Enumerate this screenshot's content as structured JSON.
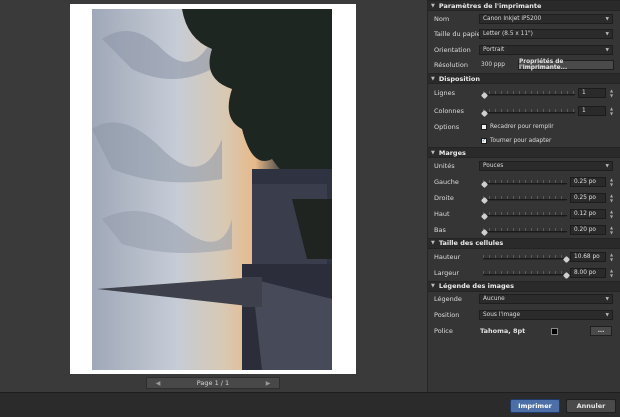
{
  "preview": {
    "pager": {
      "prev_icon": "triangle-left-icon",
      "next_icon": "triangle-right-icon",
      "label": "Page 1 / 1"
    }
  },
  "printer": {
    "title": "Paramètres de l'imprimante",
    "name_label": "Nom",
    "name_value": "Canon Inkjet iP5200",
    "paper_label": "Taille du papier",
    "paper_value": "Letter (8.5 x 11\")",
    "orientation_label": "Orientation",
    "orientation_value": "Portrait",
    "resolution_label": "Résolution",
    "resolution_value": "300 ppp",
    "properties_button": "Propriétés de l'imprimante..."
  },
  "layout": {
    "title": "Disposition",
    "rows_label": "Lignes",
    "rows_value": "1",
    "cols_label": "Colonnes",
    "cols_value": "1",
    "options_label": "Options",
    "crop_label": "Recadrer pour remplir",
    "crop_checked": false,
    "rotate_label": "Tourner pour adapter",
    "rotate_checked": true,
    "check_mark": "✓"
  },
  "margins": {
    "title": "Marges",
    "units_label": "Unités",
    "units_value": "Pouces",
    "left_label": "Gauche",
    "left_value": "0.25 po",
    "right_label": "Droite",
    "right_value": "0.25 po",
    "top_label": "Haut",
    "top_value": "0.12 po",
    "bottom_label": "Bas",
    "bottom_value": "0.20 po"
  },
  "cells": {
    "title": "Taille des cellules",
    "height_label": "Hauteur",
    "height_value": "10.68 po",
    "width_label": "Largeur",
    "width_value": "8.00 po"
  },
  "caption": {
    "title": "Légende des images",
    "caption_label": "Légende",
    "caption_value": "Aucune",
    "position_label": "Position",
    "position_value": "Sous l'image",
    "font_label": "Police",
    "font_value": "Tahoma, 8pt",
    "font_color": "#000000",
    "ellipsis_button": "..."
  },
  "footer": {
    "print": "Imprimer",
    "cancel": "Annuler"
  },
  "colors": {
    "accent": "#4c6fa8",
    "panel": "#353535",
    "header": "#2a2a2a"
  }
}
